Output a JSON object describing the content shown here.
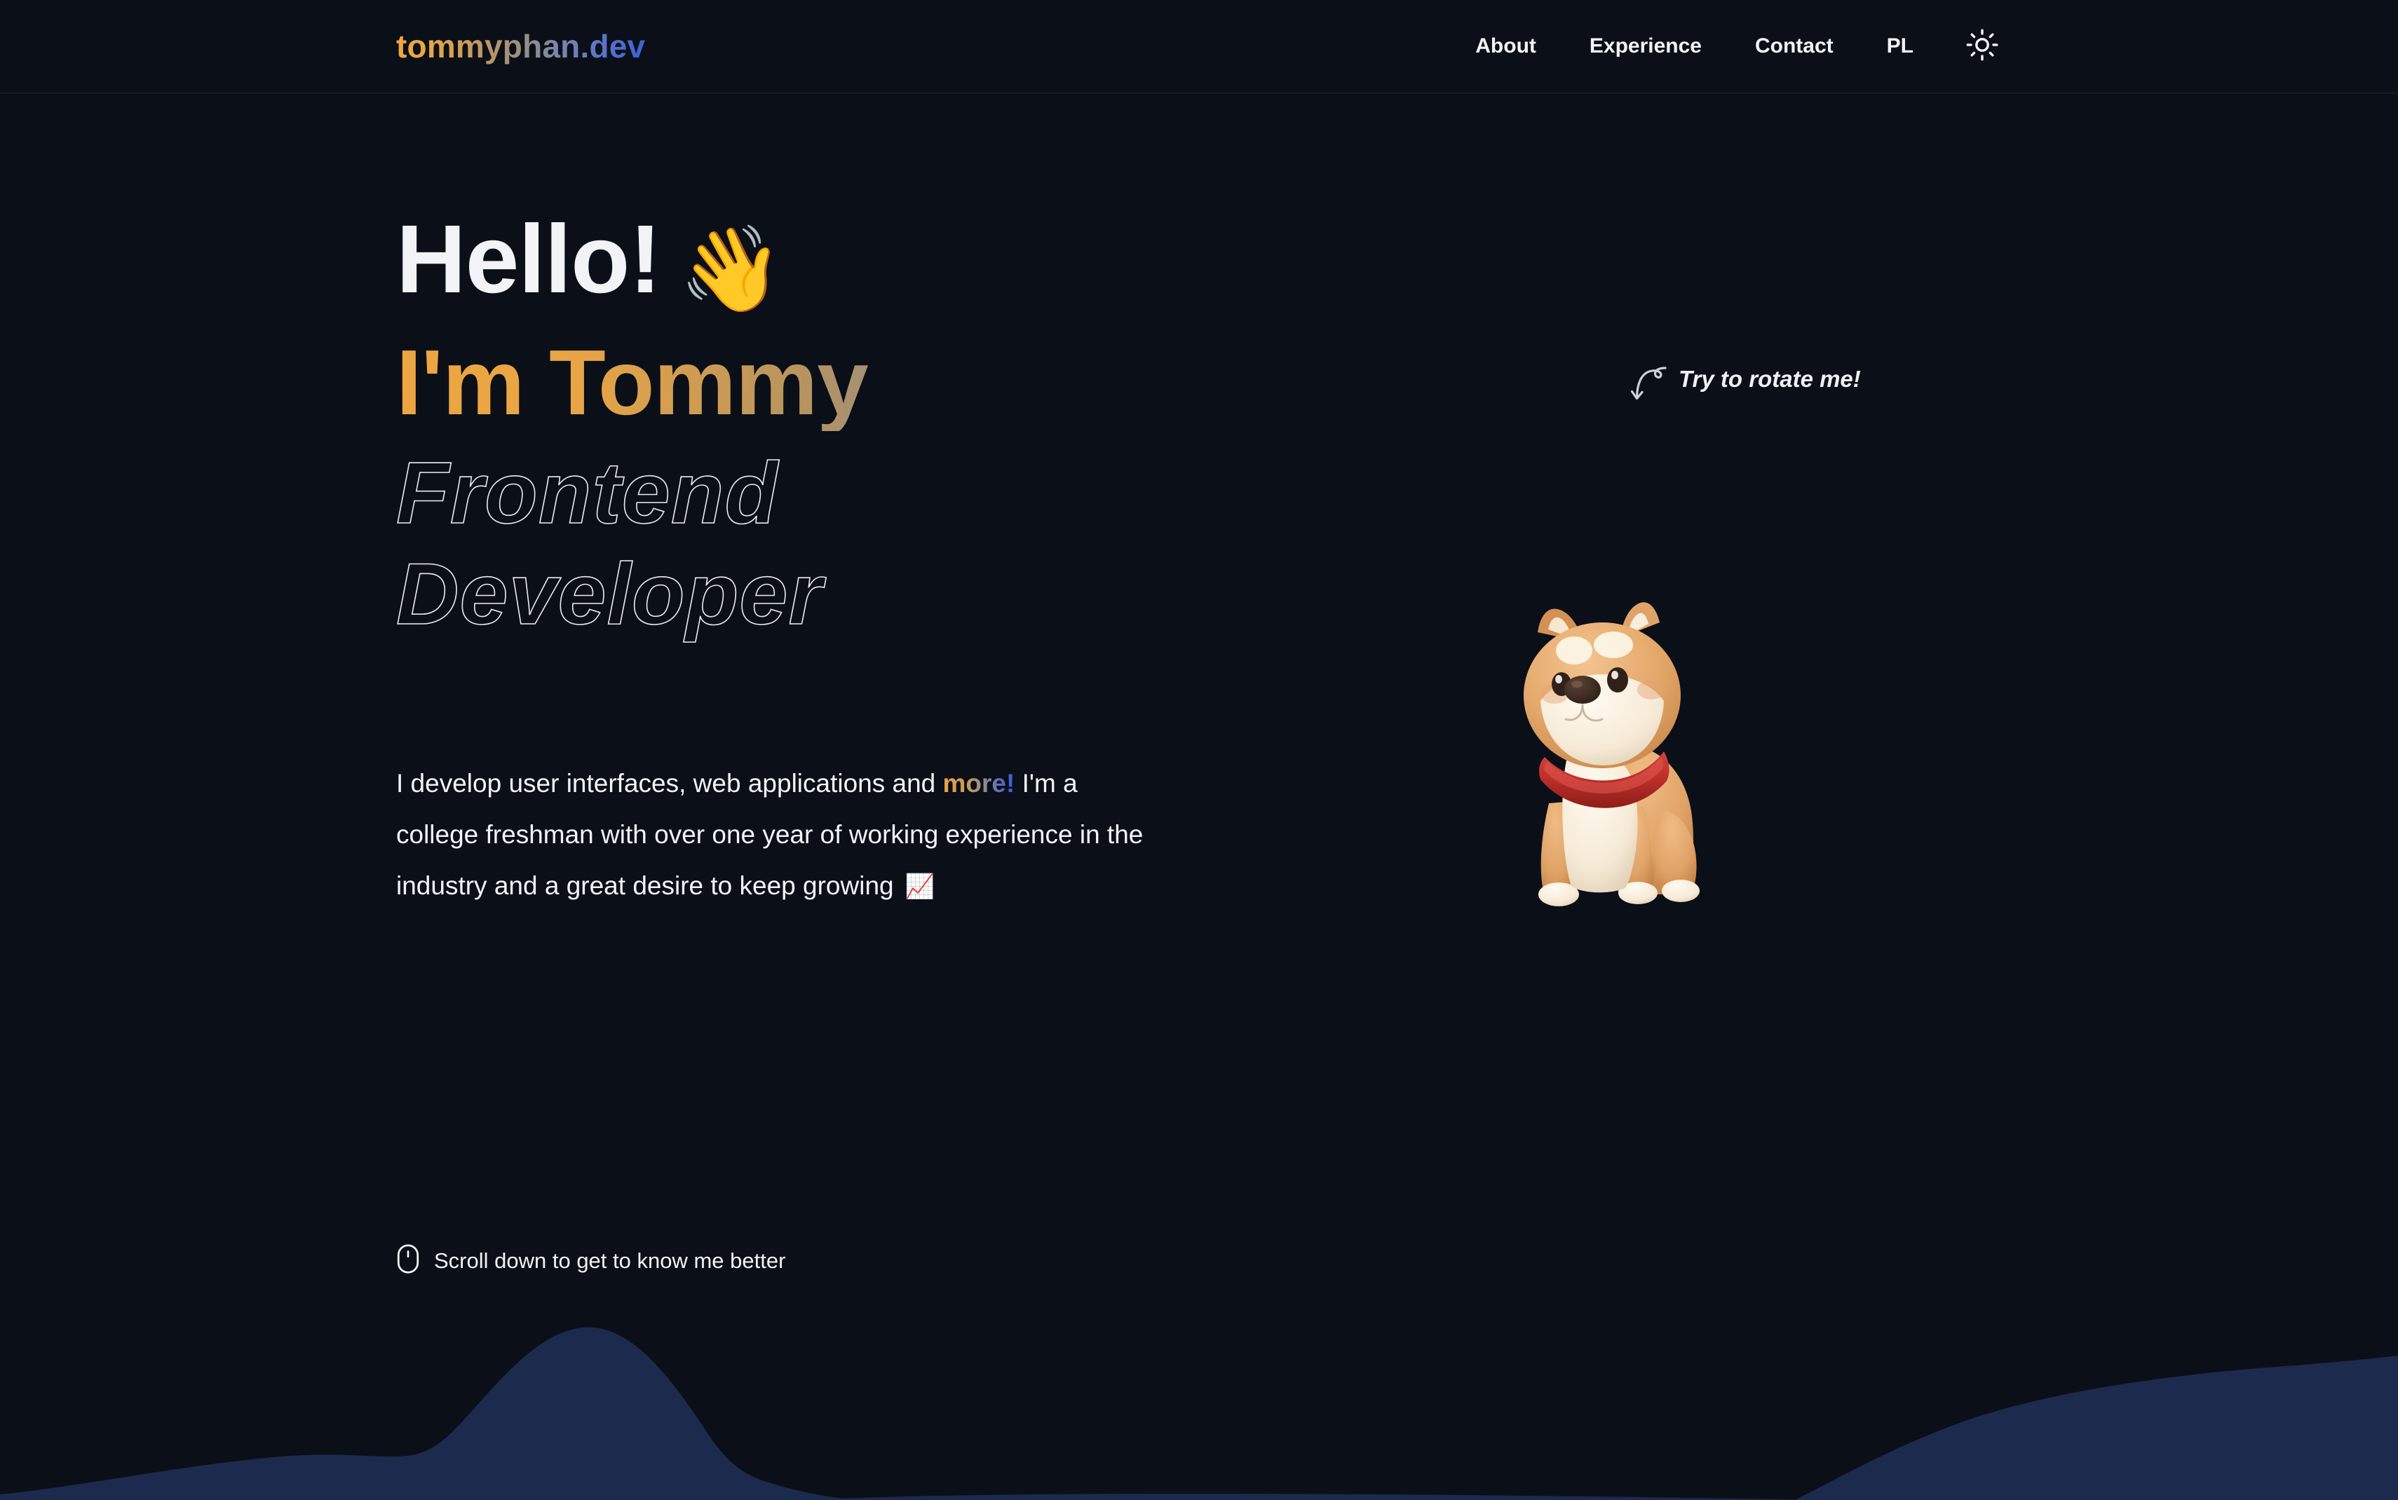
{
  "colors": {
    "background": "#0b0f18",
    "header_border": "#161b26",
    "text_primary": "#f2f3f7",
    "gradient_start": "#eda641",
    "gradient_mid": "#8c8a93",
    "gradient_end": "#3b5fdb",
    "wave": "#1c2a4d",
    "dog_fur": "#e0a567",
    "dog_collar": "#b72b28"
  },
  "header": {
    "logo_text": "tommyphan.dev",
    "nav": [
      {
        "label": "About",
        "name": "nav-item-about"
      },
      {
        "label": "Experience",
        "name": "nav-item-experience"
      },
      {
        "label": "Contact",
        "name": "nav-item-contact"
      },
      {
        "label": "PL",
        "name": "nav-item-language"
      }
    ],
    "theme_toggle_icon": "sun-icon"
  },
  "hero": {
    "greeting": "Hello!",
    "greeting_emoji": "👋",
    "name_line": "I'm Tommy",
    "role_lines": [
      "Frontend",
      "Developer"
    ],
    "paragraph": {
      "before": "I develop user interfaces, web applications and ",
      "highlight": "more!",
      "after": " I'm a college freshman with over one year of working experience in the industry and a great desire to keep growing ",
      "emoji": "📈"
    },
    "scroll_hint": {
      "icon": "mouse-icon",
      "label": "Scroll down to get to know me better"
    },
    "rotate_hint": {
      "icon": "curly-arrow-down-icon",
      "label": "Try to rotate me!"
    },
    "mascot": {
      "name": "shiba-inu-3d-model",
      "alt": "3D Shiba Inu dog with red collar"
    }
  }
}
